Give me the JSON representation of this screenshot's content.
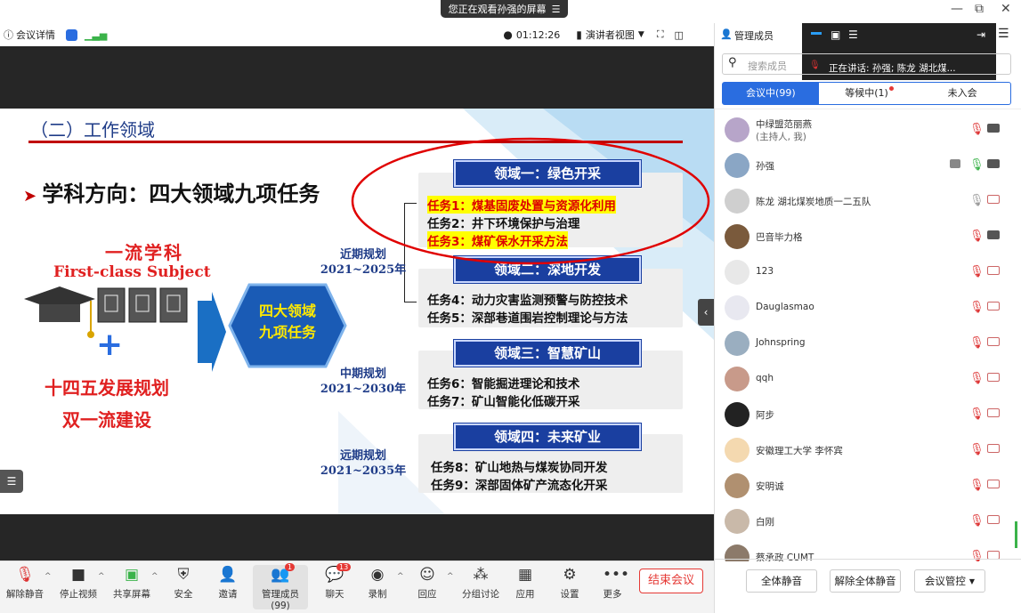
{
  "banner": {
    "text": "您正在观看孙强的屏幕",
    "menu_icon": "menu-icon"
  },
  "window": {
    "minimize": "—",
    "restore": "⧉",
    "close": "✕"
  },
  "topbar": {
    "meeting_info": "会议详情",
    "timer": "01:12:26",
    "view_label": "演讲者视图",
    "manage_members": "管理成员"
  },
  "speaker_overlay": {
    "text": "正在讲话:  孙强; 陈龙 湖北煤..."
  },
  "slide": {
    "section_title": "（二）工作领域",
    "heading": "学科方向：四大领域九项任务",
    "first_class_cn": "一流学科",
    "first_class_en": "First-class  Subject",
    "plus": "+",
    "plan_14": "十四五发展规划",
    "double": "双一流建设",
    "hex_line1": "四大领域",
    "hex_line2": "九项任务",
    "plans": [
      {
        "name": "近期规划",
        "years": "2021~2025年"
      },
      {
        "name": "中期规划",
        "years": "2021~2030年"
      },
      {
        "name": "远期规划",
        "years": "2021~2035年"
      }
    ],
    "domains": [
      {
        "title": "领域一：绿色开采",
        "tasks": [
          "任务1：煤基固废处置与资源化利用",
          "任务2：井下环境保护与治理",
          "任务3：煤矿保水开采方法"
        ]
      },
      {
        "title": "领域二：深地开发",
        "tasks": [
          "任务4：动力灾害监测预警与防控技术",
          "任务5：深部巷道围岩控制理论与方法"
        ]
      },
      {
        "title": "领域三：智慧矿山",
        "tasks": [
          "任务6：智能掘进理论和技术",
          "任务7：矿山智能化低碳开采"
        ]
      },
      {
        "title": "领域四：未来矿业",
        "tasks": [
          "任务8：矿山地热与煤炭协同开发",
          "任务9：深部固体矿产流态化开采"
        ]
      }
    ]
  },
  "bottom": {
    "items": [
      {
        "label": "解除静音",
        "icon": "mic-off-icon"
      },
      {
        "label": "停止视频",
        "icon": "video-icon"
      },
      {
        "label": "共享屏幕",
        "icon": "share-screen-icon"
      },
      {
        "label": "安全",
        "icon": "shield-icon"
      },
      {
        "label": "邀请",
        "icon": "invite-icon"
      },
      {
        "label": "管理成员(99)",
        "icon": "members-icon",
        "badge": "1"
      },
      {
        "label": "聊天",
        "icon": "chat-icon",
        "badge": "13"
      },
      {
        "label": "录制",
        "icon": "record-icon"
      },
      {
        "label": "回应",
        "icon": "reaction-icon"
      },
      {
        "label": "分组讨论",
        "icon": "breakout-icon"
      },
      {
        "label": "应用",
        "icon": "apps-icon"
      },
      {
        "label": "设置",
        "icon": "settings-icon"
      },
      {
        "label": "更多",
        "icon": "more-icon"
      }
    ],
    "end_meeting": "结束会议"
  },
  "panel": {
    "search_placeholder": "搜索成员",
    "tabs": [
      "会议中(99)",
      "等候中(1)",
      "未入会"
    ],
    "members": [
      {
        "name": "中绿盟范丽燕",
        "sub": "(主持人, 我)",
        "mic": "muted",
        "cam": "on"
      },
      {
        "name": "孙强",
        "mic": "on",
        "cam": "on"
      },
      {
        "name": "陈龙 湖北煤炭地质一二五队",
        "mic": "idle",
        "cam": "off"
      },
      {
        "name": "巴音毕力格",
        "mic": "muted",
        "cam": "on"
      },
      {
        "name": "123",
        "mic": "muted",
        "cam": "off"
      },
      {
        "name": "Dauglasmao",
        "mic": "muted",
        "cam": "off"
      },
      {
        "name": "Johnspring",
        "mic": "muted",
        "cam": "off"
      },
      {
        "name": "qqh",
        "mic": "muted",
        "cam": "off"
      },
      {
        "name": "阿步",
        "mic": "muted",
        "cam": "off"
      },
      {
        "name": "安徽理工大学 李怀宾",
        "mic": "muted",
        "cam": "off"
      },
      {
        "name": "安明诚",
        "mic": "muted",
        "cam": "off"
      },
      {
        "name": "白刚",
        "mic": "muted",
        "cam": "off"
      },
      {
        "name": "蔡承政 CUMT",
        "mic": "muted",
        "cam": "off"
      }
    ],
    "mute_all": "全体静音",
    "unmute_all": "解除全体静音",
    "meeting_control": "会议管控"
  }
}
